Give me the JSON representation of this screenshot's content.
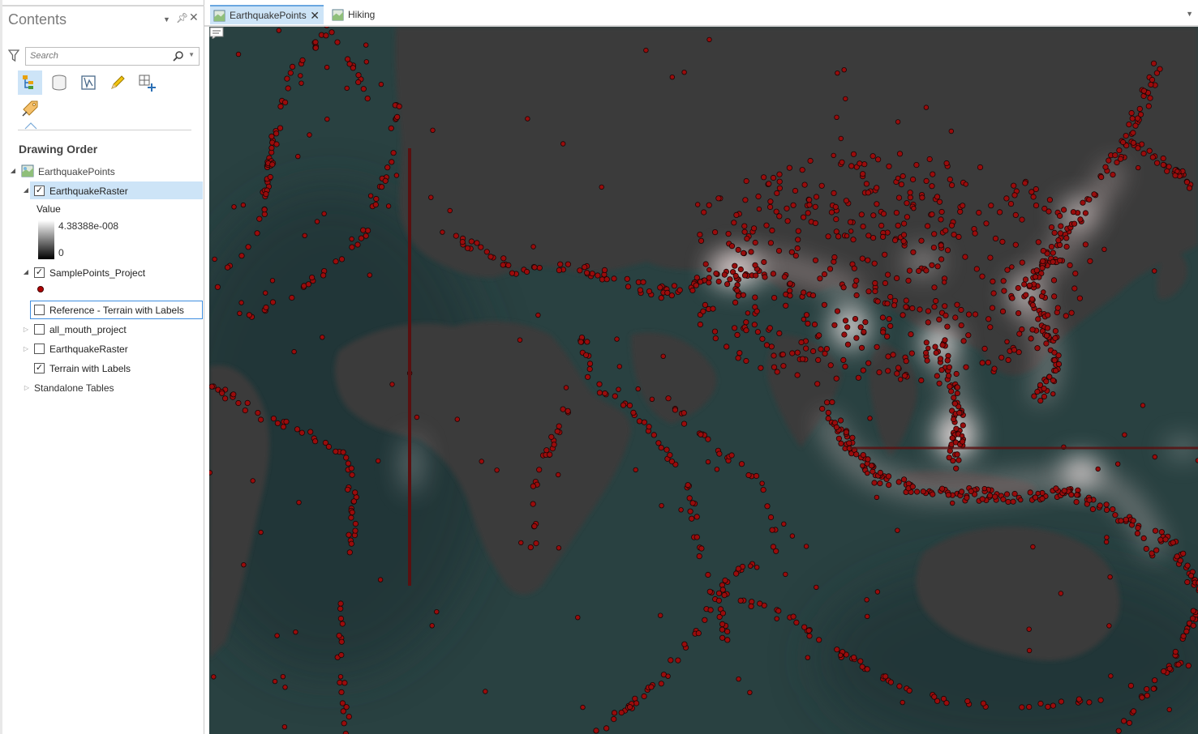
{
  "contents": {
    "title": "Contents",
    "search_placeholder": "Search",
    "section_title": "Drawing Order",
    "layers": {
      "map": "EarthquakePoints",
      "raster": "EarthquakeRaster",
      "legend_title": "Value",
      "legend_high": "4.38388e-008",
      "legend_low": "0",
      "sample": "SamplePoints_Project",
      "reference": "Reference - Terrain with Labels",
      "mouth": "all_mouth_project",
      "raster2": "EarthquakeRaster",
      "terrain": "Terrain with Labels",
      "tables": "Standalone Tables"
    },
    "checks": {
      "raster": true,
      "sample": true,
      "reference": false,
      "mouth": false,
      "raster2": false,
      "terrain": true
    }
  },
  "tabs": [
    {
      "label": "EarthquakePoints",
      "active": true
    },
    {
      "label": "Hiking",
      "active": false
    }
  ],
  "colors": {
    "selection": "#cde4f7",
    "point_fill": "#9a0c0c",
    "map_base": "#2a4040"
  }
}
